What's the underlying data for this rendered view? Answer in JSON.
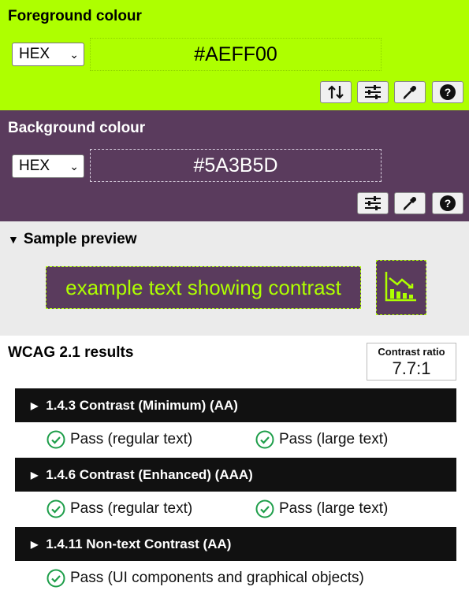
{
  "foreground": {
    "title": "Foreground colour",
    "format": "HEX",
    "value": "#AEFF00",
    "color": "#AEFF00",
    "tools": [
      "swap-icon",
      "sliders-icon",
      "eyedropper-icon",
      "help-icon"
    ]
  },
  "background": {
    "title": "Background colour",
    "format": "HEX",
    "value": "#5A3B5D",
    "color": "#5A3B5D",
    "tools": [
      "sliders-icon",
      "eyedropper-icon",
      "help-icon"
    ]
  },
  "sample": {
    "title": "Sample preview",
    "text": "example text showing contrast",
    "icon": "chart-icon"
  },
  "results": {
    "title": "WCAG 2.1 results",
    "ratio_label": "Contrast ratio",
    "ratio_value": "7.7:1",
    "criteria": [
      {
        "label": "1.4.3 Contrast (Minimum) (AA)",
        "results": [
          "Pass (regular text)",
          "Pass (large text)"
        ]
      },
      {
        "label": "1.4.6 Contrast (Enhanced) (AAA)",
        "results": [
          "Pass (regular text)",
          "Pass (large text)"
        ]
      },
      {
        "label": "1.4.11 Non-text Contrast (AA)",
        "results": [
          "Pass (UI components and graphical objects)"
        ]
      }
    ]
  }
}
